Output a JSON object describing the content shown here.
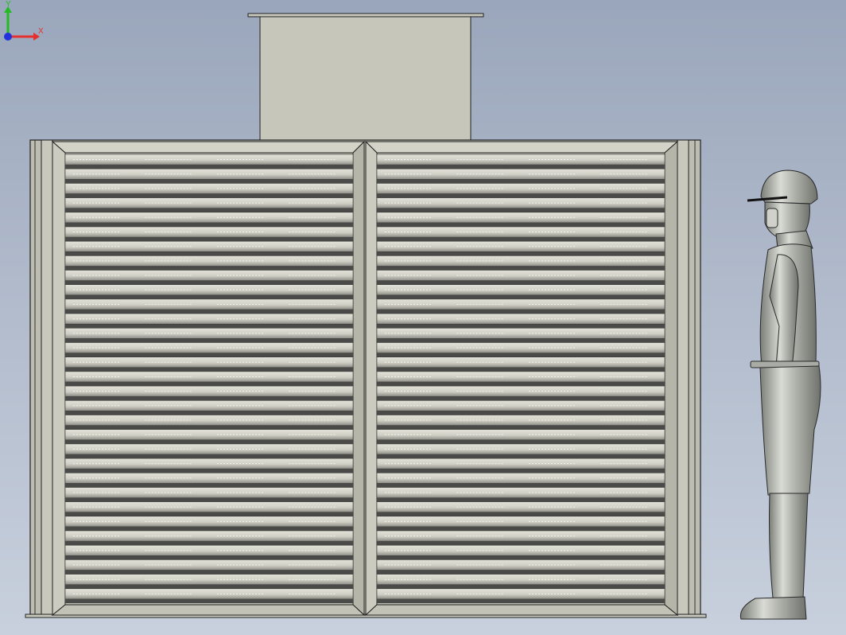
{
  "scene": {
    "background": {
      "top": "#9aa6bb",
      "bottom": "#c8d0dd"
    },
    "model": {
      "body_color": "#c9c9bd",
      "frame_color": "#b9b9ad",
      "edge_color": "#222222",
      "louver_light": "#d9d9cf",
      "louver_dark": "#4a4a48",
      "louver_rows": 31,
      "louver_panels": 2
    },
    "scale_figure": {
      "description_icon": "human-figure-icon",
      "color": "#b9bcb4"
    }
  },
  "triad": {
    "x_label": "X",
    "y_label": "Y",
    "x_color": "#e53030",
    "y_color": "#22bb22",
    "z_color": "#2233dd"
  }
}
